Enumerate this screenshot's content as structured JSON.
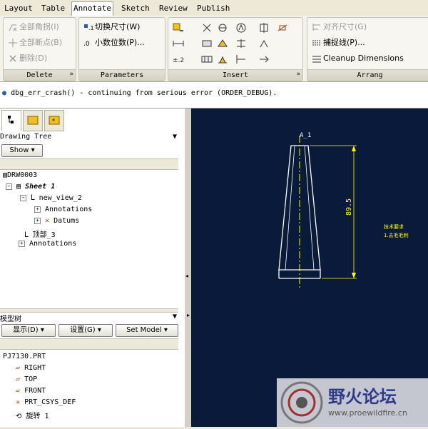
{
  "tabs": [
    "Layout",
    "Table",
    "Annotate",
    "Sketch",
    "Review",
    "Publish"
  ],
  "active_tab": "Annotate",
  "ribbon": {
    "delete_group": {
      "title": "Delete",
      "items": [
        "全部角拐(I)",
        "全部断点(B)",
        "删除(D)"
      ]
    },
    "parameters_group": {
      "title": "Parameters",
      "items": [
        "切换尺寸(W)",
        "小数位数(P)..."
      ]
    },
    "insert_group": {
      "title": "Insert"
    },
    "arrange_group": {
      "title": "Arrang",
      "items": [
        "对齐尺寸(G)",
        "捕捉线(P)...",
        "Cleanup Dimensions"
      ]
    }
  },
  "message": "dbg_err_crash() - continuing from serious error (ORDER_DEBUG).",
  "drawing_tree": {
    "header": "Drawing Tree",
    "show_button": "Show",
    "items": [
      {
        "label": "DRW0003",
        "bold": false
      },
      {
        "label": "Sheet 1",
        "bold": true
      },
      {
        "label": "new_view_2",
        "bold": false
      },
      {
        "label": "Annotations",
        "bold": false
      },
      {
        "label": "Datums",
        "bold": false
      },
      {
        "label": "顶部_3",
        "bold": false
      },
      {
        "label": "Annotations",
        "bold": false
      }
    ]
  },
  "model_tree": {
    "header": "模型树",
    "display_button": "显示(D)",
    "settings_button": "设置(G)",
    "set_model_button": "Set Model",
    "items": [
      "PJ7130.PRT",
      "RIGHT",
      "TOP",
      "FRONT",
      "PRT_CSYS_DEF",
      "旋转 1"
    ]
  },
  "canvas": {
    "axis_label": "A_1",
    "dimension_value": "89.5",
    "note_line1": "技术要求",
    "note_line2": "1.去毛毛刺"
  },
  "watermark": {
    "title": "野火论坛",
    "url": "www.proewildfire.cn"
  },
  "colors": {
    "canvas_bg": "#0a1a3a",
    "geometry": "#ffffff",
    "dimension": "#ffff00",
    "active_tab_bg": "#ffffff"
  }
}
